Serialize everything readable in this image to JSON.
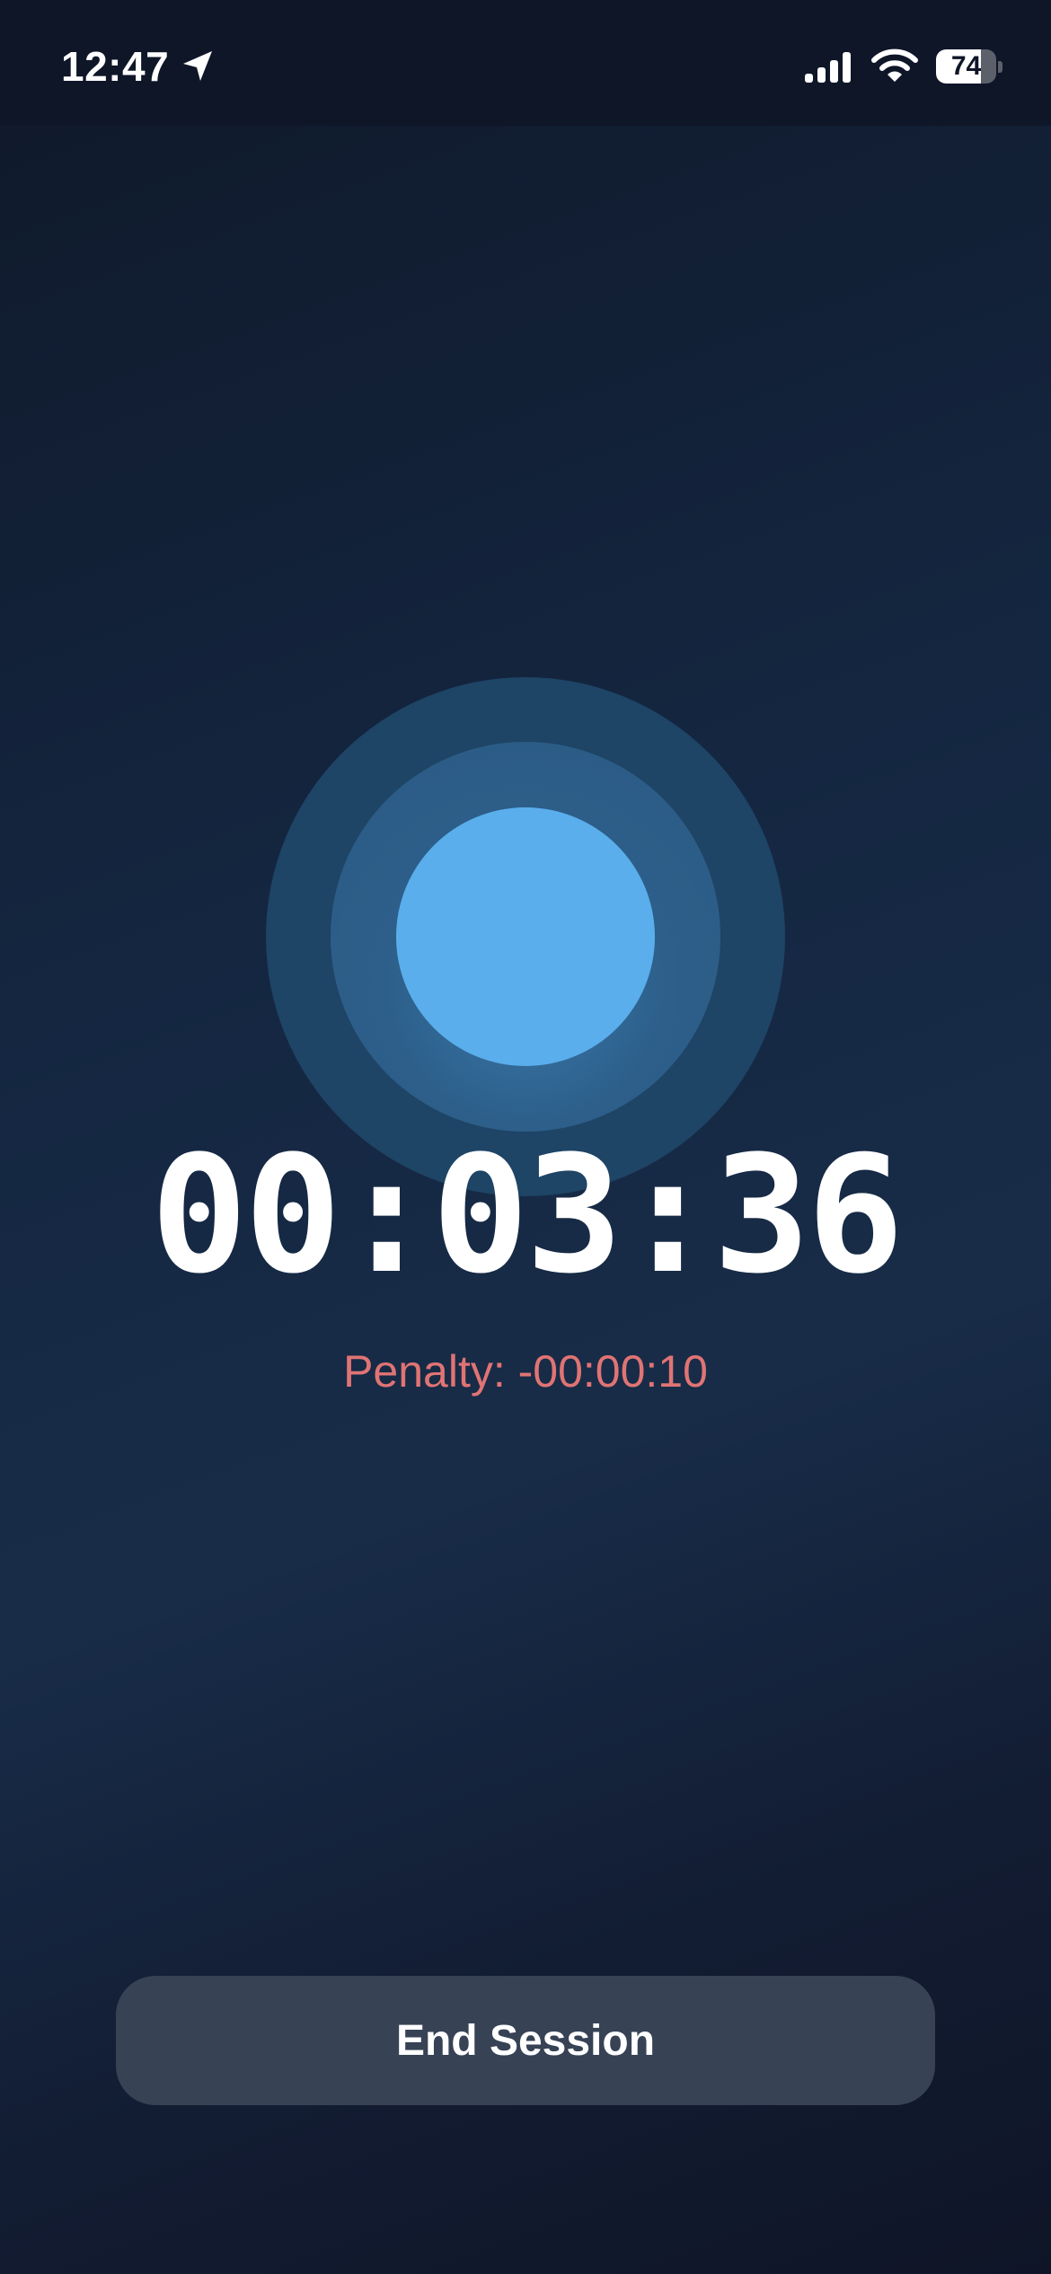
{
  "status_bar": {
    "time": "12:47",
    "battery_level": "74",
    "battery_fraction": 0.74,
    "icons": [
      "location-arrow-icon",
      "cellular-signal-icon",
      "wifi-icon",
      "battery-icon"
    ]
  },
  "session": {
    "timer": "00:03:36",
    "penalty": "Penalty: -00:00:10",
    "end_button_label": "End Session"
  },
  "colors": {
    "background": "#142640",
    "orb_core": "#5aaeec",
    "orb_ring_middle": "#2d5f8a",
    "orb_ring_outer": "#1e4466",
    "penalty_text": "#e07474",
    "button_background": "#374255"
  }
}
